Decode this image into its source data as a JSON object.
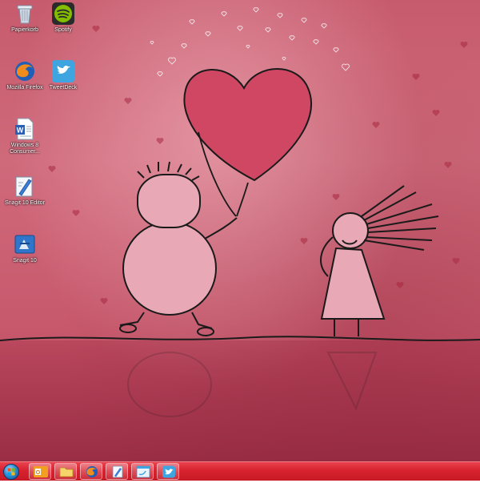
{
  "desktop": {
    "icons": [
      {
        "label": "Papierkorb"
      },
      {
        "label": "Spotify"
      },
      {
        "label": "Mozilla Firefox"
      },
      {
        "label": "TweetDeck"
      },
      {
        "label": "Windows 8 Consumer..."
      },
      {
        "label": "Snagit 10 Editor"
      },
      {
        "label": "Snagit 10"
      }
    ]
  },
  "taskbar": {
    "start_icon": "windows-start-orb",
    "pinned": [
      "outlook-icon",
      "folder-icon",
      "firefox-icon",
      "snagit-editor-icon",
      "tweetdeck-window-icon",
      "twitter-icon"
    ]
  },
  "colors": {
    "taskbar": "#d8222f",
    "wallpaper": "#c65b6d"
  }
}
